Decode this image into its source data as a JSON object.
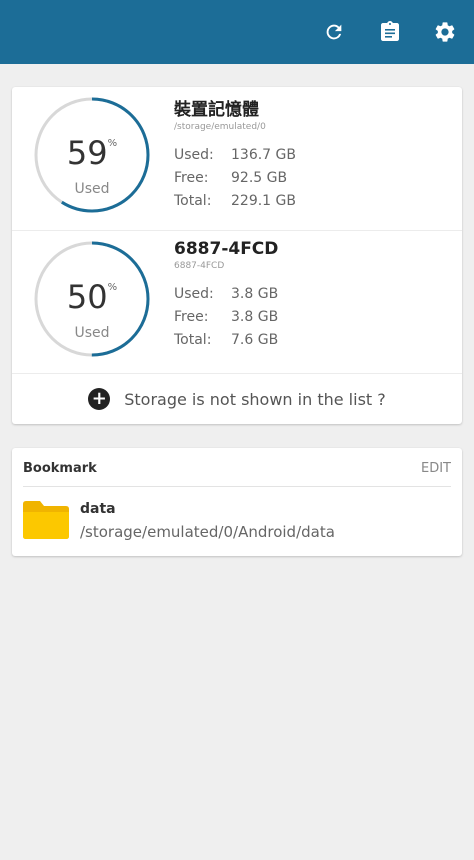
{
  "toolbar": {
    "refresh_icon": "refresh-icon",
    "clipboard_icon": "clipboard-icon",
    "settings_icon": "gear-icon",
    "color": "#1c6d97"
  },
  "storages": [
    {
      "percent": "59",
      "percent_value": 59,
      "percent_unit": "%",
      "used_label": "Used",
      "name": "裝置記憶體",
      "path": "/storage/emulated/0",
      "used_key": "Used:",
      "used_value": "136.7 GB",
      "free_key": "Free:",
      "free_value": "92.5 GB",
      "total_key": "Total:",
      "total_value": "229.1 GB"
    },
    {
      "percent": "50",
      "percent_value": 50,
      "percent_unit": "%",
      "used_label": "Used",
      "name": "6887-4FCD",
      "path": "6887-4FCD",
      "used_key": "Used:",
      "used_value": "3.8 GB",
      "free_key": "Free:",
      "free_value": "3.8 GB",
      "total_key": "Total:",
      "total_value": "7.6 GB"
    }
  ],
  "storage_not_shown": "Storage is not shown in the list ?",
  "bookmark": {
    "title": "Bookmark",
    "edit_label": "EDIT",
    "items": [
      {
        "name": "data",
        "path": "/storage/emulated/0/Android/data"
      }
    ]
  },
  "colors": {
    "gauge_used": "#1c6d97",
    "gauge_track": "#d8d8d8",
    "folder": "#fcc800"
  }
}
